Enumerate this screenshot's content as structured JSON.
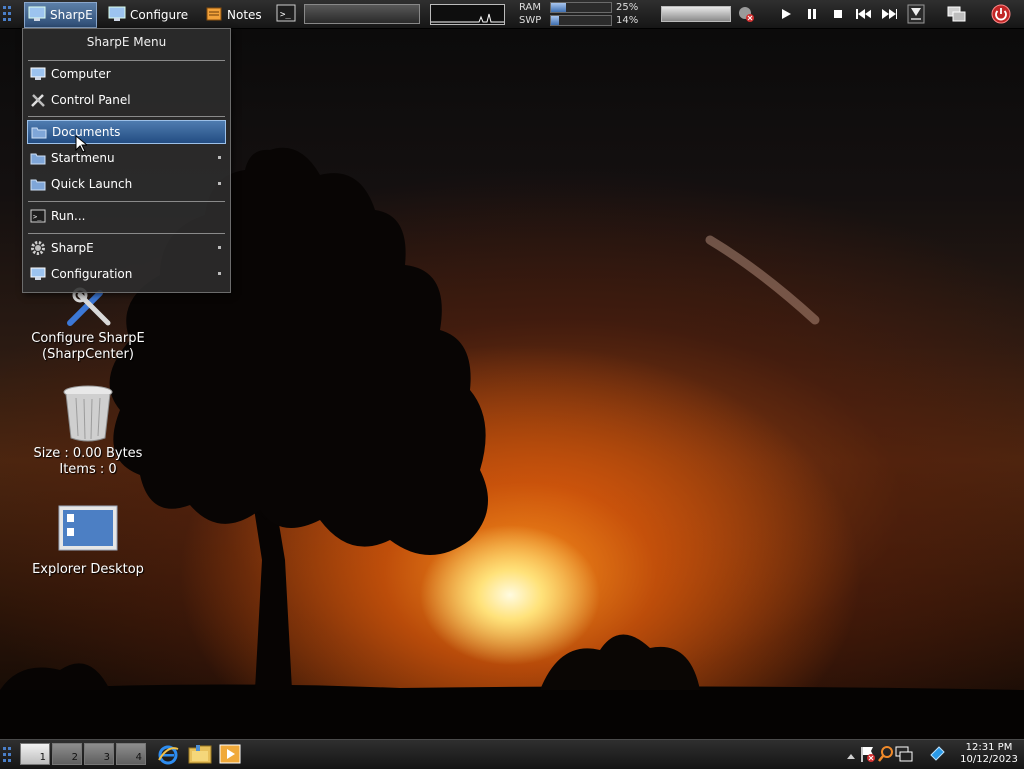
{
  "topbar": {
    "sharpe_label": "SharpE",
    "configure_label": "Configure",
    "notes_label": "Notes",
    "ram_label": "RAM",
    "swp_label": "SWP",
    "ram_percent": "25%",
    "swp_percent": "14%",
    "ram_level": 0.25,
    "swp_level": 0.14
  },
  "menu": {
    "title": "SharpE Menu",
    "items": [
      {
        "label": "Computer",
        "icon": "monitor-icon",
        "submenu": false
      },
      {
        "label": "Control Panel",
        "icon": "tools-icon",
        "submenu": false
      },
      {
        "label": "Documents",
        "icon": "folder-icon",
        "submenu": false,
        "highlighted": true
      },
      {
        "label": "Startmenu",
        "icon": "folder-icon",
        "submenu": true
      },
      {
        "label": "Quick Launch",
        "icon": "folder-icon",
        "submenu": true
      },
      {
        "label": "Run...",
        "icon": "terminal-icon",
        "submenu": false
      },
      {
        "label": "SharpE",
        "icon": "gear-icon",
        "submenu": true
      },
      {
        "label": "Configuration",
        "icon": "monitor-icon",
        "submenu": true
      }
    ]
  },
  "desktop": {
    "configure": {
      "line1": "Configure SharpE",
      "line2": "(SharpCenter)"
    },
    "recycle": {
      "line1": "Size : 0.00 Bytes",
      "line2": "Items : 0"
    },
    "explorer": {
      "line1": "Explorer Desktop"
    }
  },
  "taskbar": {
    "workspaces": [
      "1",
      "2",
      "3",
      "4"
    ],
    "active_workspace": "1",
    "clock_time": "12:31 PM",
    "clock_date": "10/12/2023"
  },
  "colors": {
    "accent": "#3f6fb0",
    "highlight": "#4f7cb0",
    "power": "#d93030"
  }
}
